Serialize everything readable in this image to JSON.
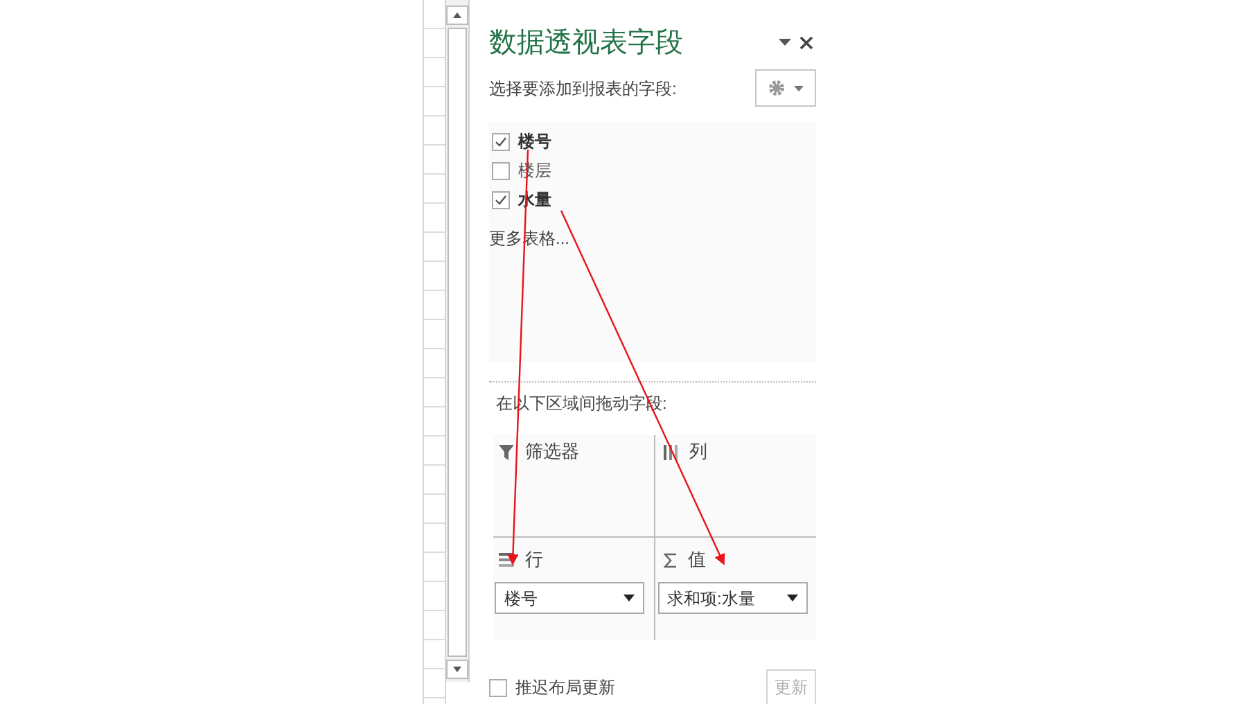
{
  "panel": {
    "title": "数据透视表字段",
    "subtitle": "选择要添加到报表的字段:",
    "fields": [
      {
        "label": "楼号",
        "checked": true
      },
      {
        "label": "楼层",
        "checked": false
      },
      {
        "label": "水量",
        "checked": true
      }
    ],
    "more_tables": "更多表格...",
    "areas_label": "在以下区域间拖动字段:",
    "areas": [
      {
        "kind": "filter",
        "label": "筛选器"
      },
      {
        "kind": "columns",
        "label": "列"
      },
      {
        "kind": "rows",
        "label": "行",
        "items": [
          "楼号"
        ]
      },
      {
        "kind": "values",
        "label": "值",
        "items": [
          "求和项:水量"
        ]
      }
    ],
    "defer_update": {
      "label": "推迟布局更新",
      "checked": false
    },
    "update_button": {
      "label": "更新",
      "disabled": true
    }
  }
}
